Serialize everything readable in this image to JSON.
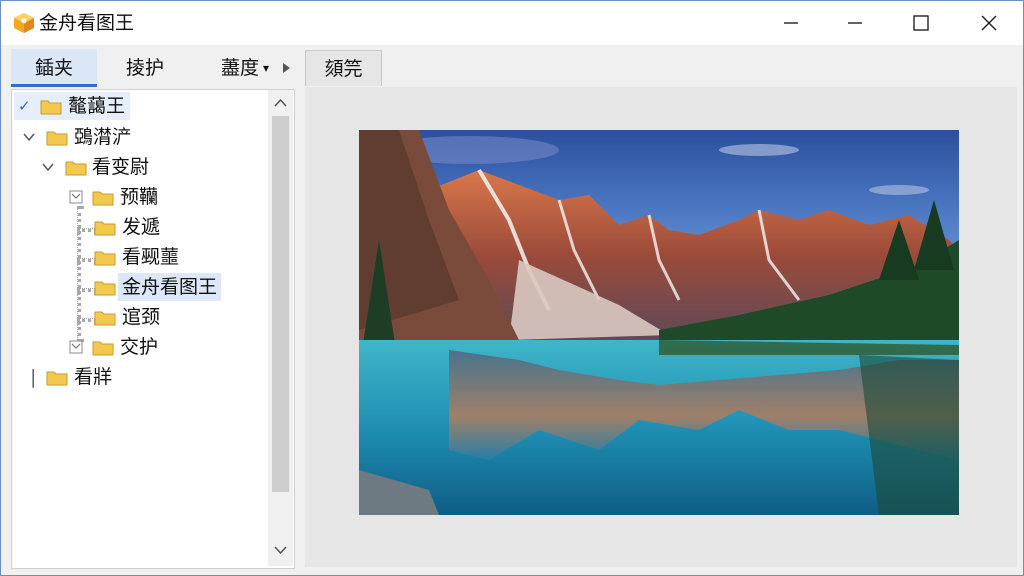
{
  "window": {
    "title": "金舟看图王",
    "app_icon": "box-logo-icon",
    "controls": [
      "minimize-icon",
      "maximize-icon",
      "close-icon"
    ]
  },
  "tabs": {
    "tab1": "鍤夹",
    "tab2": "掕护",
    "tab3": "藎度",
    "tab3_arrow": "▾",
    "right_tab": "頦笎"
  },
  "tree": {
    "items": [
      {
        "label": "鼇藹王",
        "icon": "folder-icon"
      },
      {
        "label": "鵶潸浐",
        "icon": "folder-icon"
      },
      {
        "label": "看变尉",
        "icon": "folder-icon"
      },
      {
        "label": "预韊",
        "icon": "folder-icon"
      },
      {
        "label": "发遞",
        "icon": "folder-icon"
      },
      {
        "label": "看觋蘁",
        "icon": "folder-icon"
      },
      {
        "label": "金舟看图王",
        "icon": "folder-icon"
      },
      {
        "label": "逭颈",
        "icon": "folder-icon"
      },
      {
        "label": "交护",
        "icon": "folder-icon"
      },
      {
        "label": "看牂",
        "icon": "folder-icon"
      }
    ],
    "check_mark": "✓"
  },
  "viewer": {
    "image": "mountain-lake-reflection"
  },
  "colors": {
    "accent": "#2e6fd1",
    "folder": "#f2c94c",
    "selected": "#dce8f8"
  }
}
